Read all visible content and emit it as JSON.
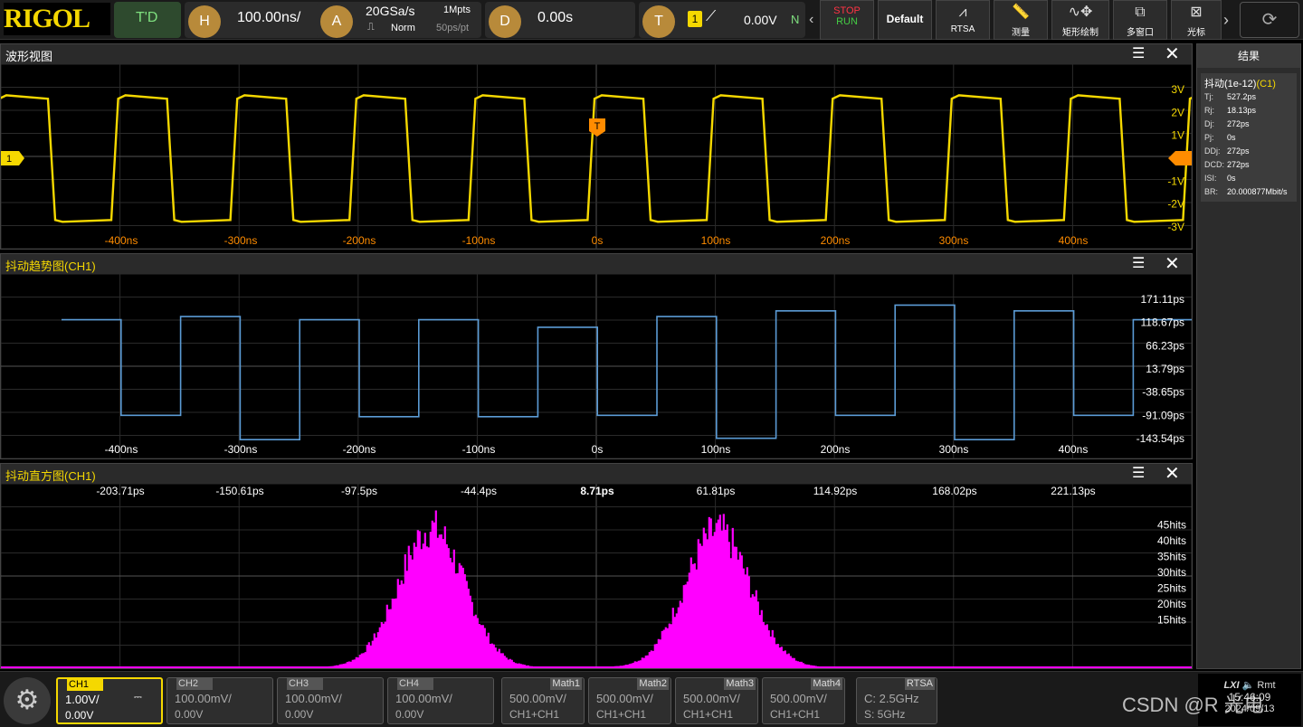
{
  "topbar": {
    "logo": "RIGOL",
    "td": "T'D",
    "h_btn": "H",
    "timebase": "100.00ns/",
    "a_btn": "A",
    "sample_rate": "20GSa/s",
    "mode": "Norm",
    "memory": "1Mpts",
    "per_point": "50ps/pt",
    "d_btn": "D",
    "delay": "0.00s",
    "t_btn": "T",
    "trig_ch": "1",
    "trig_level": "0.00V",
    "trig_mode": "N",
    "stop": "STOP",
    "run": "RUN",
    "default": "Default",
    "rtsa": "RTSA",
    "measure": "测量",
    "rect_draw": "矩形绘制",
    "multi_window": "多窗口",
    "cursor": "光标"
  },
  "wave_panel": {
    "title": "波形视图",
    "trigger_marker": "T",
    "channel_marker": "1",
    "y_labels": [
      "3V",
      "2V",
      "1V",
      "0V",
      "-1V",
      "-2V",
      "-3V"
    ],
    "x_labels": [
      "-400ns",
      "-300ns",
      "-200ns",
      "-100ns",
      "0s",
      "100ns",
      "200ns",
      "300ns",
      "400ns"
    ]
  },
  "trend_panel": {
    "title": "抖动趋势图(CH1)",
    "y_labels": [
      "171.11ps",
      "118.67ps",
      "66.23ps",
      "13.79ps",
      "-38.65ps",
      "-91.09ps",
      "-143.54ps"
    ],
    "x_labels": [
      "-400ns",
      "-300ns",
      "-200ns",
      "-100ns",
      "0s",
      "100ns",
      "200ns",
      "300ns",
      "400ns"
    ]
  },
  "hist_panel": {
    "title": "抖动直方图(CH1)",
    "x_labels": [
      "-203.71ps",
      "-150.61ps",
      "-97.5ps",
      "-44.4ps",
      "8.71ps",
      "61.81ps",
      "114.92ps",
      "168.02ps",
      "221.13ps"
    ],
    "y_labels": [
      "45hits",
      "40hits",
      "35hits",
      "30hits",
      "25hits",
      "20hits",
      "15hits"
    ]
  },
  "results": {
    "header": "结果",
    "title": "抖动(1e-12)",
    "channel": "(C1)",
    "rows": [
      {
        "k": "Tj:",
        "v": "527.2ps"
      },
      {
        "k": "Rj:",
        "v": "18.13ps"
      },
      {
        "k": "Dj:",
        "v": "272ps"
      },
      {
        "k": "Pj:",
        "v": "0s"
      },
      {
        "k": "DDj:",
        "v": "272ps"
      },
      {
        "k": "DCD:",
        "v": "272ps"
      },
      {
        "k": "ISI:",
        "v": "0s"
      },
      {
        "k": "BR:",
        "v": "20.000877Mbit/s"
      }
    ]
  },
  "bottombar": {
    "channels": [
      {
        "name": "CH1",
        "scale": "1.00V/",
        "offset": "0.00V"
      },
      {
        "name": "CH2",
        "scale": "100.00mV/",
        "offset": "0.00V"
      },
      {
        "name": "CH3",
        "scale": "100.00mV/",
        "offset": "0.00V"
      },
      {
        "name": "CH4",
        "scale": "100.00mV/",
        "offset": "0.00V"
      }
    ],
    "maths": [
      {
        "name": "Math1",
        "scale": "500.00mV/",
        "src": "CH1+CH1"
      },
      {
        "name": "Math2",
        "scale": "500.00mV/",
        "src": "CH1+CH1"
      },
      {
        "name": "Math3",
        "scale": "500.00mV/",
        "src": "CH1+CH1"
      },
      {
        "name": "Math4",
        "scale": "500.00mV/",
        "src": "CH1+CH1"
      }
    ],
    "rtsa": {
      "name": "RTSA",
      "center": "C: 2.5GHz",
      "span": "S: 5GHz"
    },
    "status_lxi": "LXI",
    "status_rmt": "Rmt",
    "time": "15:46:09",
    "date": "2024/09/13",
    "watermark": "CSDN @R 光电"
  },
  "trend_chart_data": {
    "segments_ps": [
      125,
      -91,
      132,
      -146,
      125,
      -94,
      125,
      -94,
      108,
      -91,
      132,
      -143,
      145,
      -91,
      158,
      -146,
      145,
      -91,
      125,
      -146
    ]
  },
  "colors": {
    "ch1": "#f5d800",
    "trend": "#5b9bd5",
    "hist": "#ff00ff",
    "axis_orange": "#ff8c00"
  }
}
